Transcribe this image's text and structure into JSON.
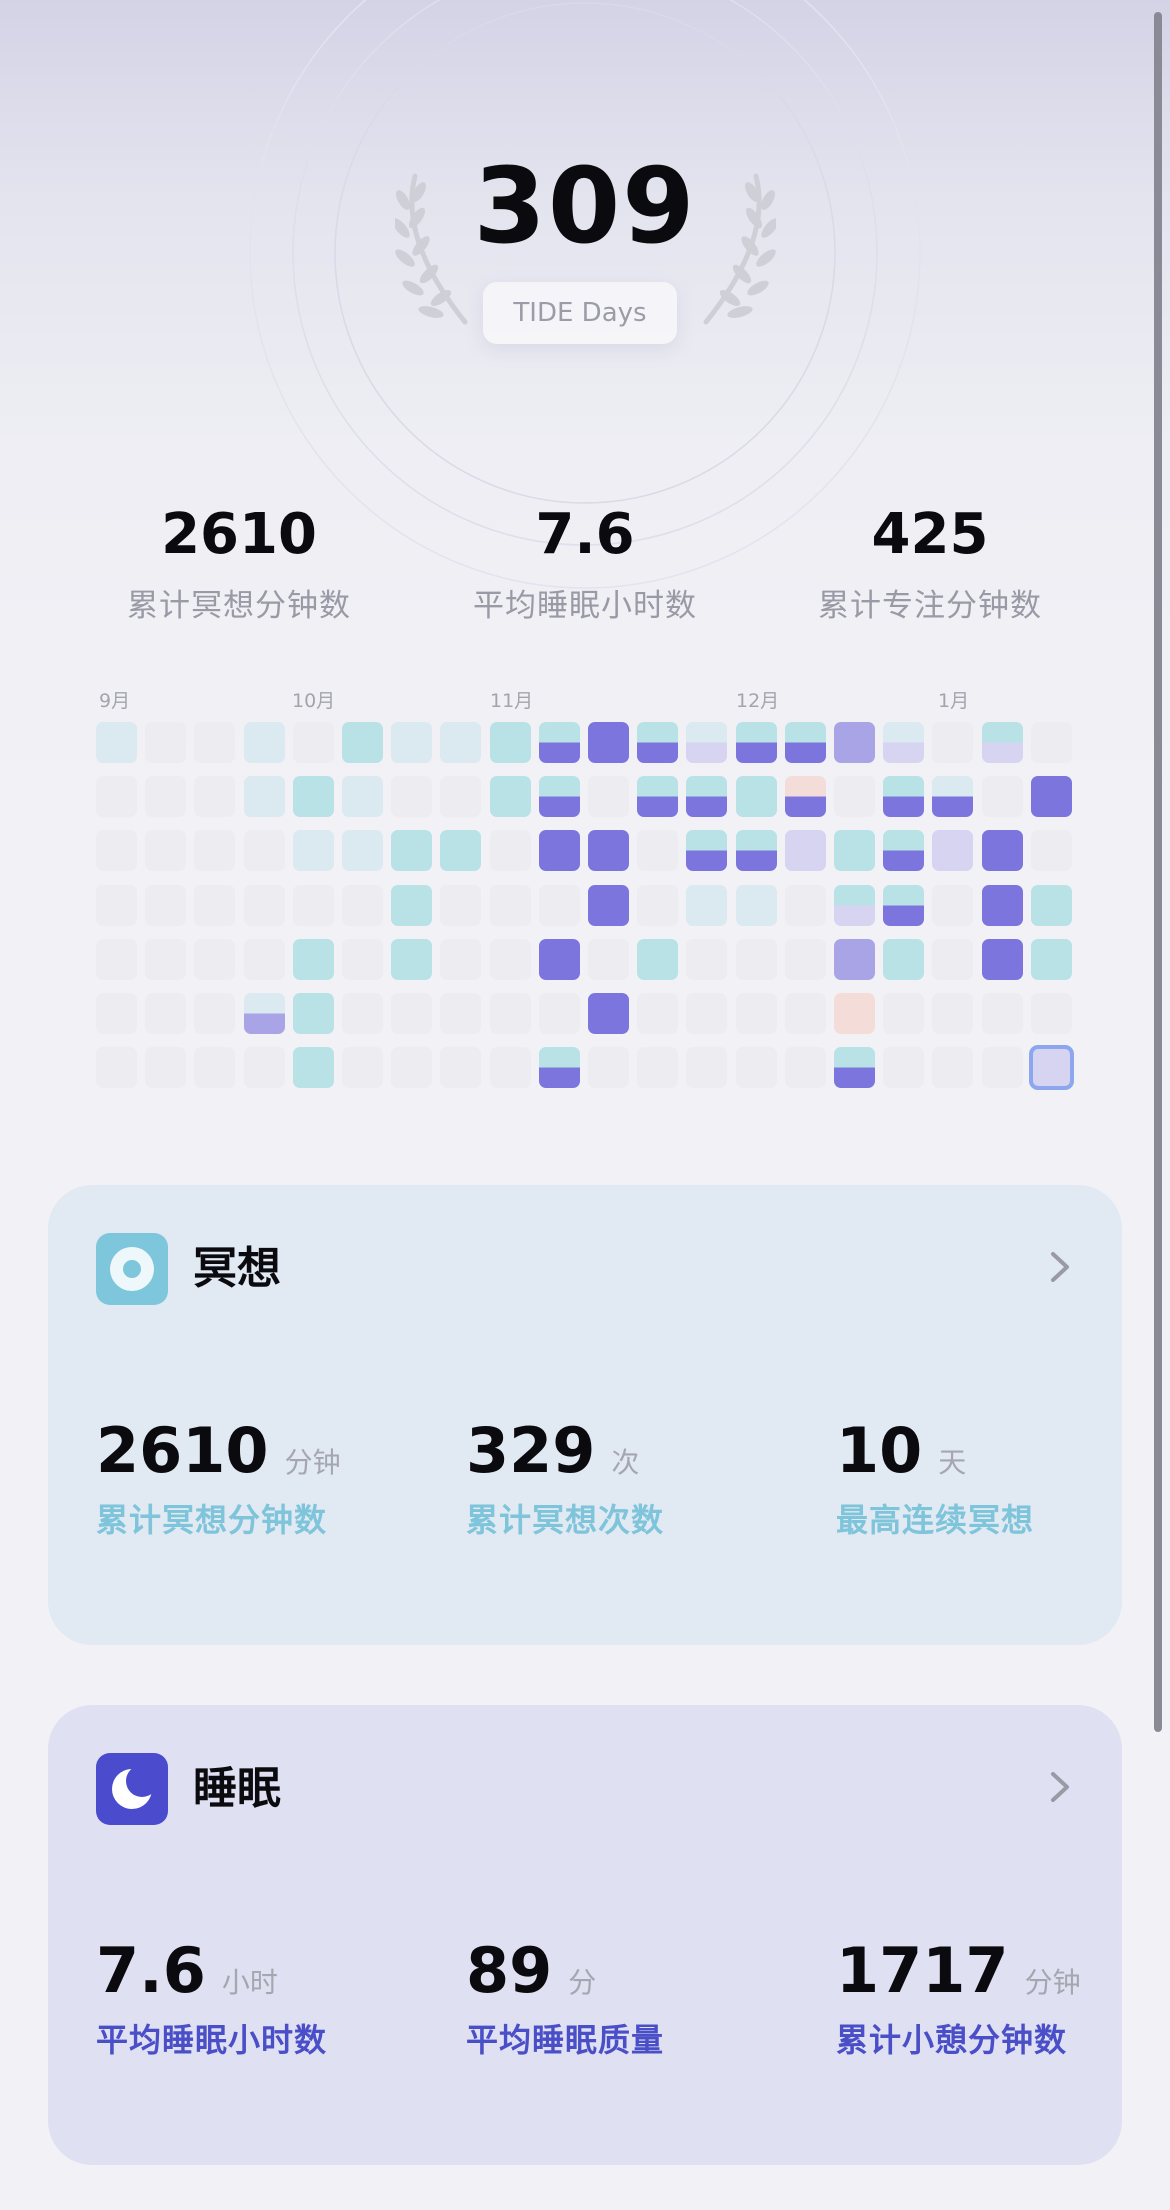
{
  "header": {
    "total_days": "309",
    "days_label": "TIDE Days"
  },
  "summary": [
    {
      "value": "2610",
      "label": "累计冥想分钟数"
    },
    {
      "value": "7.6",
      "label": "平均睡眠小时数"
    },
    {
      "value": "425",
      "label": "累计专注分钟数"
    }
  ],
  "heatmap": {
    "months": [
      "9月",
      "10月",
      "11月",
      "12月",
      "1月"
    ],
    "levels": {
      "e": "empty",
      "l": "light-cyan",
      "c": "cyan",
      "p": "purple",
      "v": "lavender",
      "w": "light-lavender",
      "o": "peach",
      "cp": "cyan-over-purple",
      "lw": "light-over-lavender",
      "cw": "cyan-over-lavender",
      "lp": "light-over-purple"
    },
    "colors": {
      "empty": "#ececf1",
      "light-cyan": "#dbe9f0",
      "cyan": "#b8e2e6",
      "purple": "#7b75dd",
      "lavender": "#a9a4e6",
      "light-lavender": "#d6d4f1",
      "peach": "#f4ddd8",
      "selected-outline": "#8ca6ef"
    },
    "grid": [
      [
        "l",
        "e",
        "e",
        "l",
        "e",
        "c",
        "l",
        "l",
        "c",
        "cp",
        "p",
        "cp",
        "lw",
        "cp",
        "cp",
        "v",
        "lw",
        "e",
        "cw",
        "e"
      ],
      [
        "e",
        "e",
        "e",
        "l",
        "c",
        "l",
        "e",
        "e",
        "c",
        "cp",
        "e",
        "cp",
        "cp",
        "c",
        "op",
        "e",
        "cp",
        "lp",
        "e",
        "p"
      ],
      [
        "e",
        "e",
        "e",
        "e",
        "l",
        "l",
        "c",
        "c",
        "e",
        "p",
        "p",
        "e",
        "cp",
        "cp",
        "w",
        "c",
        "cp",
        "w",
        "p",
        "e"
      ],
      [
        "e",
        "e",
        "e",
        "e",
        "e",
        "e",
        "c",
        "e",
        "e",
        "e",
        "p",
        "e",
        "l",
        "l",
        "e",
        "cw",
        "cp",
        "e",
        "p",
        "c"
      ],
      [
        "e",
        "e",
        "e",
        "e",
        "c",
        "e",
        "c",
        "e",
        "e",
        "p",
        "e",
        "c",
        "e",
        "e",
        "e",
        "v",
        "c",
        "e",
        "p",
        "c"
      ],
      [
        "e",
        "e",
        "e",
        "lv",
        "c",
        "e",
        "e",
        "e",
        "e",
        "e",
        "p",
        "e",
        "e",
        "e",
        "e",
        "o",
        "e",
        "e",
        "e",
        "e"
      ],
      [
        "e",
        "e",
        "e",
        "e",
        "c",
        "e",
        "e",
        "e",
        "e",
        "cp",
        "e",
        "e",
        "e",
        "e",
        "e",
        "cp",
        "e",
        "e",
        "e",
        "sel"
      ]
    ]
  },
  "meditation": {
    "title": "冥想",
    "icon": "meditation-ring-icon",
    "metrics": [
      {
        "value": "2610",
        "unit": "分钟",
        "label": "累计冥想分钟数"
      },
      {
        "value": "329",
        "unit": "次",
        "label": "累计冥想次数"
      },
      {
        "value": "10",
        "unit": "天",
        "label": "最高连续冥想"
      }
    ]
  },
  "sleep": {
    "title": "睡眠",
    "icon": "moon-icon",
    "metrics": [
      {
        "value": "7.6",
        "unit": "小时",
        "label": "平均睡眠小时数"
      },
      {
        "value": "89",
        "unit": "分",
        "label": "平均睡眠质量"
      },
      {
        "value": "1717",
        "unit": "分钟",
        "label": "累计小憩分钟数"
      }
    ]
  }
}
